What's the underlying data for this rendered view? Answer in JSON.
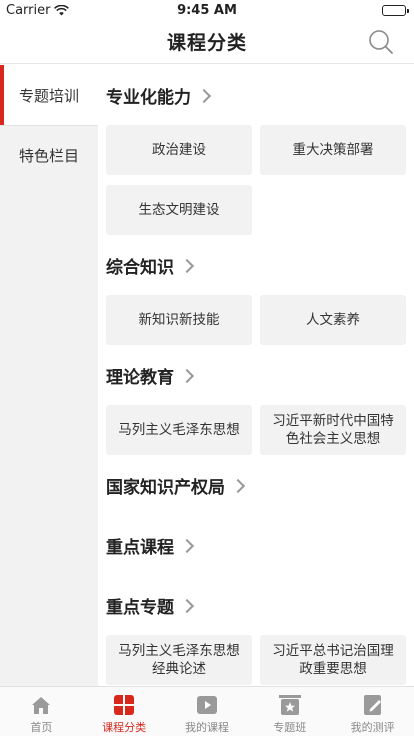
{
  "status": {
    "carrier": "Carrier",
    "time": "9:45 AM"
  },
  "nav": {
    "title": "课程分类",
    "search_icon": "search-icon"
  },
  "sidebar": {
    "items": [
      {
        "label": "专题培训",
        "active": true
      },
      {
        "label": "特色栏目",
        "active": false
      }
    ]
  },
  "sections": [
    {
      "title": "专业化能力",
      "items": [
        "政治建设",
        "重大决策部署",
        "生态文明建设"
      ]
    },
    {
      "title": "综合知识",
      "items": [
        "新知识新技能",
        "人文素养"
      ]
    },
    {
      "title": "理论教育",
      "items": [
        "马列主义毛泽东思想",
        "习近平新时代中国特色社会主义思想"
      ]
    },
    {
      "title": "国家知识产权局",
      "items": []
    },
    {
      "title": "重点课程",
      "items": []
    },
    {
      "title": "重点专题",
      "items": [
        "马列主义毛泽东思想经典论述",
        "习近平总书记治国理政重要思想"
      ]
    }
  ],
  "tabs": [
    {
      "label": "首页",
      "icon": "home-icon",
      "active": false
    },
    {
      "label": "课程分类",
      "icon": "category-grid-icon",
      "active": true
    },
    {
      "label": "我的课程",
      "icon": "play-icon",
      "active": false
    },
    {
      "label": "专题班",
      "icon": "star-board-icon",
      "active": false
    },
    {
      "label": "我的测评",
      "icon": "pencil-doc-icon",
      "active": false
    }
  ],
  "colors": {
    "accent": "#d8281e",
    "sidebar_bg": "#f2f2f2",
    "chip_bg": "#f2f2f2"
  }
}
